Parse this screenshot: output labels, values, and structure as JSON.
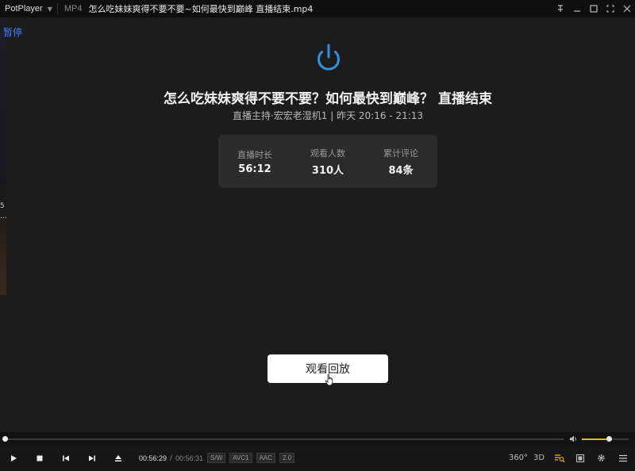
{
  "titlebar": {
    "app_name": "PotPlayer",
    "format": "MP4",
    "file_title": "怎么吃妹妹爽得不要不要~如何最快到巅峰 直播结束.mp4"
  },
  "osd": {
    "status": "暂停"
  },
  "left_edge": {
    "text1": "5",
    "text2": "..."
  },
  "stream": {
    "headline": "怎么吃妹妹爽得不要不要？如何最快到巅峰？ 直播结束",
    "meta": "直播主持·宏宏老湿机1 | 昨天 20:16 - 21:13",
    "stats": [
      {
        "label": "直播时长",
        "value": "56:12"
      },
      {
        "label": "观看人数",
        "value": "310人"
      },
      {
        "label": "累计评论",
        "value": "84条"
      }
    ],
    "replay_label": "观看回放"
  },
  "playback": {
    "current_time": "00:56:29",
    "separator": "/",
    "total_time": "00:56:31",
    "badges": [
      "S/W",
      "AVC1",
      "AAC",
      "2.0"
    ],
    "progress_fraction": 0.0,
    "volume_fraction": 0.58
  },
  "controls": {
    "vr_label": "360°",
    "threed_label": "3D"
  },
  "colors": {
    "accent": "#2f8fe6",
    "volume": "#e6b800",
    "osd": "#4a7cff"
  }
}
